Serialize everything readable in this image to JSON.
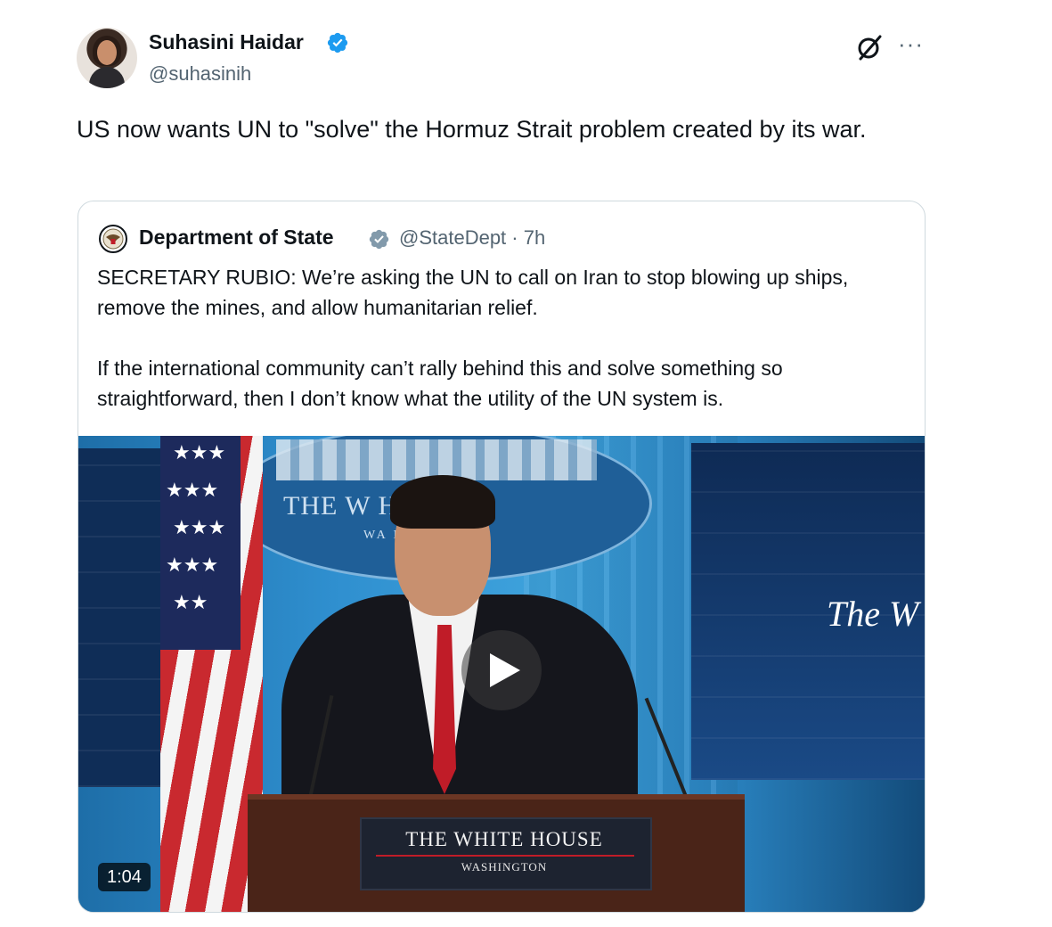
{
  "tweet": {
    "author_name": "Suhasini Haidar",
    "author_handle": "@suhasinih",
    "text": "US now wants UN to \"solve\" the Hormuz Strait problem created by its war."
  },
  "quote": {
    "author_name": "Department of State",
    "author_handle": "@StateDept · 7h",
    "paragraphs": [
      "SECRETARY RUBIO: We’re asking the UN to call on Iran to stop blowing up ships, remove the mines, and allow humanitarian relief.",
      "If the international community can’t rally behind this and solve something so straightforward, then I don’t know what the utility of the UN system is."
    ]
  },
  "video": {
    "duration": "1:04",
    "seal_text": "THE W    HOUSE",
    "seal_sub": "WA        N",
    "screen_text": "The W",
    "podium_title": "THE WHITE HOUSE",
    "podium_sub": "WASHINGTON"
  },
  "icons": {
    "verified": "verified-badge-icon",
    "grok": "grok-icon",
    "more": "more-icon",
    "play": "play-icon"
  },
  "colors": {
    "verified_blue": "#1d9bf0",
    "text": "#0f1419",
    "secondary": "#536471",
    "border": "#cfd9de"
  }
}
